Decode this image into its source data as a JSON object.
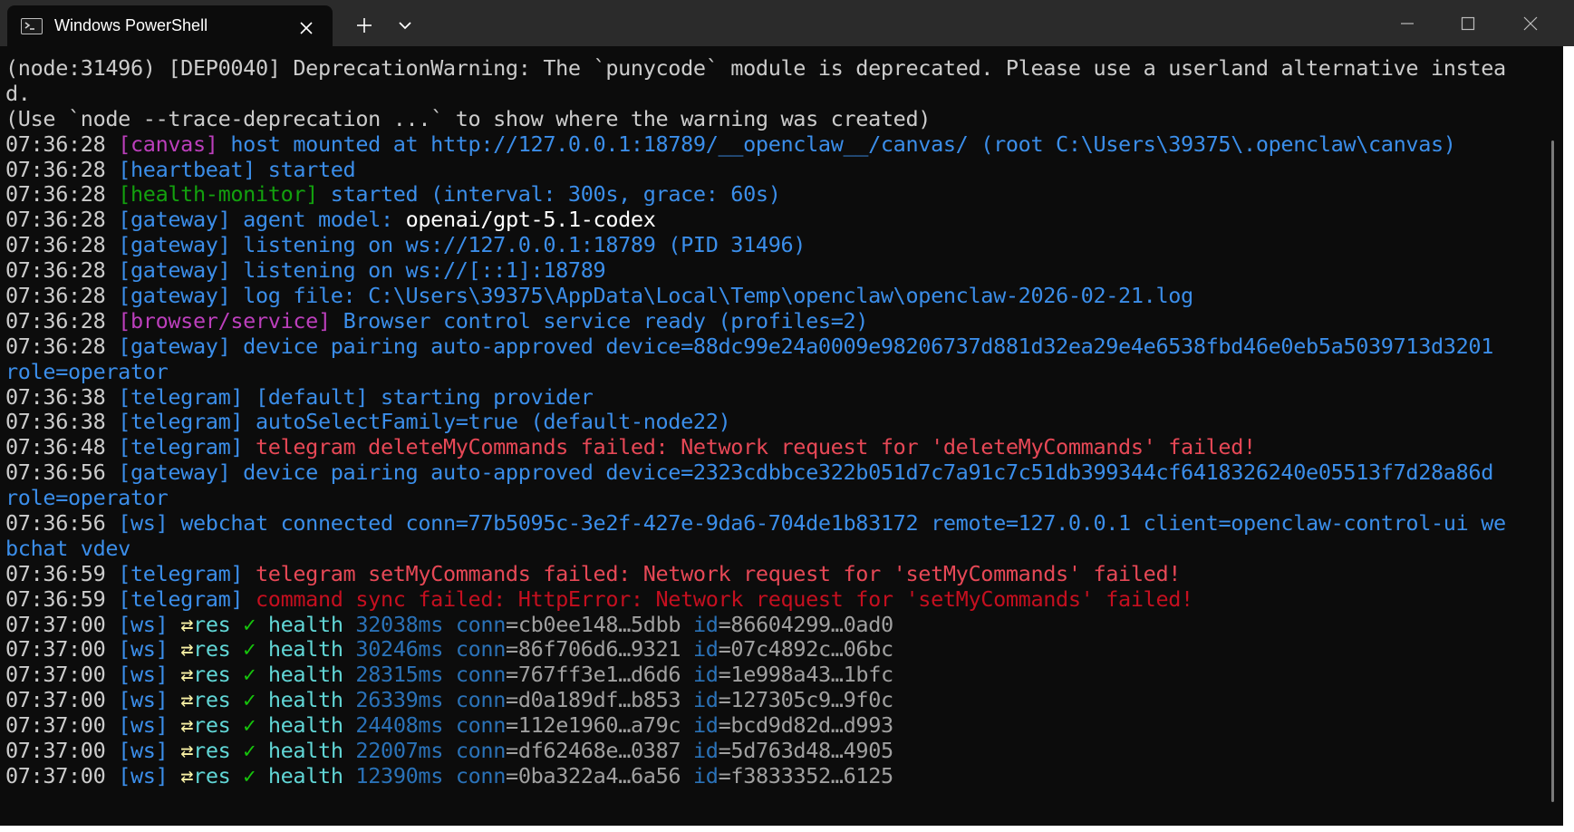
{
  "window": {
    "tab_title": "Windows PowerShell",
    "icons": {
      "tab": "terminal-icon",
      "close": "close-icon",
      "new_tab": "plus-icon",
      "dropdown": "chevron-down-icon",
      "minimize": "minimize-icon",
      "maximize": "maximize-icon",
      "window_close": "close-icon"
    }
  },
  "console": {
    "lines": [
      [
        {
          "t": "(node:31496) [DEP0040] DeprecationWarning: The `punycode` module is deprecated. Please use a userland alternative instea",
          "c": "gray"
        }
      ],
      [
        {
          "t": "d.",
          "c": "gray"
        }
      ],
      [
        {
          "t": "(Use `node --trace-deprecation ...` to show where the warning was created)",
          "c": "gray"
        }
      ],
      [
        {
          "t": "07:36:28 ",
          "c": "gray"
        },
        {
          "t": "[canvas]",
          "c": "magenta"
        },
        {
          "t": " host mounted at http://127.0.0.1:18789/__openclaw__/canvas/ (root C:\\Users\\39375\\.openclaw\\canvas)",
          "c": "blue"
        }
      ],
      [
        {
          "t": "07:36:28 ",
          "c": "gray"
        },
        {
          "t": "[heartbeat]",
          "c": "blue"
        },
        {
          "t": " started",
          "c": "blue"
        }
      ],
      [
        {
          "t": "07:36:28 ",
          "c": "gray"
        },
        {
          "t": "[health-monitor]",
          "c": "green"
        },
        {
          "t": " started (interval: 300s, grace: 60s)",
          "c": "blue"
        }
      ],
      [
        {
          "t": "07:36:28 ",
          "c": "gray"
        },
        {
          "t": "[gateway]",
          "c": "blue"
        },
        {
          "t": " agent model: ",
          "c": "blue"
        },
        {
          "t": "openai/gpt-5.1-codex",
          "c": "white"
        }
      ],
      [
        {
          "t": "07:36:28 ",
          "c": "gray"
        },
        {
          "t": "[gateway]",
          "c": "blue"
        },
        {
          "t": " listening on ws://127.0.0.1:18789 (PID 31496)",
          "c": "blue"
        }
      ],
      [
        {
          "t": "07:36:28 ",
          "c": "gray"
        },
        {
          "t": "[gateway]",
          "c": "blue"
        },
        {
          "t": " listening on ws://[::1]:18789",
          "c": "blue"
        }
      ],
      [
        {
          "t": "07:36:28 ",
          "c": "gray"
        },
        {
          "t": "[gateway]",
          "c": "blue"
        },
        {
          "t": " log file: C:\\Users\\39375\\AppData\\Local\\Temp\\openclaw\\openclaw-2026-02-21.log",
          "c": "blue"
        }
      ],
      [
        {
          "t": "07:36:28 ",
          "c": "gray"
        },
        {
          "t": "[browser/service]",
          "c": "magenta"
        },
        {
          "t": " Browser control service ready (profiles=2)",
          "c": "blue"
        }
      ],
      [
        {
          "t": "07:36:28 ",
          "c": "gray"
        },
        {
          "t": "[gateway]",
          "c": "blue"
        },
        {
          "t": " device pairing auto-approved device=88dc99e24a0009e98206737d881d32ea29e4e6538fbd46e0eb5a5039713d3201",
          "c": "blue"
        }
      ],
      [
        {
          "t": "role=operator",
          "c": "blue"
        }
      ],
      [
        {
          "t": "07:36:38 ",
          "c": "gray"
        },
        {
          "t": "[telegram]",
          "c": "blue"
        },
        {
          "t": " [default] starting provider",
          "c": "blue"
        }
      ],
      [
        {
          "t": "07:36:38 ",
          "c": "gray"
        },
        {
          "t": "[telegram]",
          "c": "blue"
        },
        {
          "t": " autoSelectFamily=true (default-node22)",
          "c": "blue"
        }
      ],
      [
        {
          "t": "07:36:48 ",
          "c": "gray"
        },
        {
          "t": "[telegram]",
          "c": "blue"
        },
        {
          "t": " telegram deleteMyCommands failed: Network request for 'deleteMyCommands' failed!",
          "c": "red"
        }
      ],
      [
        {
          "t": "07:36:56 ",
          "c": "gray"
        },
        {
          "t": "[gateway]",
          "c": "blue"
        },
        {
          "t": " device pairing auto-approved device=2323cdbbce322b051d7c7a91c7c51db399344cf6418326240e05513f7d28a86d",
          "c": "blue"
        }
      ],
      [
        {
          "t": "role=operator",
          "c": "blue"
        }
      ],
      [
        {
          "t": "07:36:56 ",
          "c": "gray"
        },
        {
          "t": "[ws]",
          "c": "blue"
        },
        {
          "t": " webchat connected conn=77b5095c-3e2f-427e-9da6-704de1b83172 remote=127.0.0.1 client=openclaw-control-ui we",
          "c": "blue"
        }
      ],
      [
        {
          "t": "bchat vdev",
          "c": "blue"
        }
      ],
      [
        {
          "t": "07:36:59 ",
          "c": "gray"
        },
        {
          "t": "[telegram]",
          "c": "blue"
        },
        {
          "t": " telegram setMyCommands failed: Network request for 'setMyCommands' failed!",
          "c": "red"
        }
      ],
      [
        {
          "t": "07:36:59 ",
          "c": "gray"
        },
        {
          "t": "[telegram]",
          "c": "blue"
        },
        {
          "t": " command sync failed: HttpError: Network request for 'setMyCommands' failed!",
          "c": "red2"
        }
      ],
      [
        {
          "t": "07:37:00 ",
          "c": "gray"
        },
        {
          "t": "[ws]",
          "c": "blue"
        },
        {
          "t": " ",
          "c": "gray"
        },
        {
          "t": "⇄",
          "c": "yellow"
        },
        {
          "t": "res ",
          "c": "cyan"
        },
        {
          "t": "✓",
          "c": "bgreen"
        },
        {
          "t": " health ",
          "c": "cyan"
        },
        {
          "t": "32038ms ",
          "c": "dim"
        },
        {
          "t": "conn",
          "c": "dim"
        },
        {
          "t": "=cb0ee148…5dbb ",
          "c": "lgray"
        },
        {
          "t": "id",
          "c": "dim"
        },
        {
          "t": "=86604299…0ad0",
          "c": "lgray"
        }
      ],
      [
        {
          "t": "07:37:00 ",
          "c": "gray"
        },
        {
          "t": "[ws]",
          "c": "blue"
        },
        {
          "t": " ",
          "c": "gray"
        },
        {
          "t": "⇄",
          "c": "yellow"
        },
        {
          "t": "res ",
          "c": "cyan"
        },
        {
          "t": "✓",
          "c": "bgreen"
        },
        {
          "t": " health ",
          "c": "cyan"
        },
        {
          "t": "30246ms ",
          "c": "dim"
        },
        {
          "t": "conn",
          "c": "dim"
        },
        {
          "t": "=86f706d6…9321 ",
          "c": "lgray"
        },
        {
          "t": "id",
          "c": "dim"
        },
        {
          "t": "=07c4892c…06bc",
          "c": "lgray"
        }
      ],
      [
        {
          "t": "07:37:00 ",
          "c": "gray"
        },
        {
          "t": "[ws]",
          "c": "blue"
        },
        {
          "t": " ",
          "c": "gray"
        },
        {
          "t": "⇄",
          "c": "yellow"
        },
        {
          "t": "res ",
          "c": "cyan"
        },
        {
          "t": "✓",
          "c": "bgreen"
        },
        {
          "t": " health ",
          "c": "cyan"
        },
        {
          "t": "28315ms ",
          "c": "dim"
        },
        {
          "t": "conn",
          "c": "dim"
        },
        {
          "t": "=767ff3e1…d6d6 ",
          "c": "lgray"
        },
        {
          "t": "id",
          "c": "dim"
        },
        {
          "t": "=1e998a43…1bfc",
          "c": "lgray"
        }
      ],
      [
        {
          "t": "07:37:00 ",
          "c": "gray"
        },
        {
          "t": "[ws]",
          "c": "blue"
        },
        {
          "t": " ",
          "c": "gray"
        },
        {
          "t": "⇄",
          "c": "yellow"
        },
        {
          "t": "res ",
          "c": "cyan"
        },
        {
          "t": "✓",
          "c": "bgreen"
        },
        {
          "t": " health ",
          "c": "cyan"
        },
        {
          "t": "26339ms ",
          "c": "dim"
        },
        {
          "t": "conn",
          "c": "dim"
        },
        {
          "t": "=d0a189df…b853 ",
          "c": "lgray"
        },
        {
          "t": "id",
          "c": "dim"
        },
        {
          "t": "=127305c9…9f0c",
          "c": "lgray"
        }
      ],
      [
        {
          "t": "07:37:00 ",
          "c": "gray"
        },
        {
          "t": "[ws]",
          "c": "blue"
        },
        {
          "t": " ",
          "c": "gray"
        },
        {
          "t": "⇄",
          "c": "yellow"
        },
        {
          "t": "res ",
          "c": "cyan"
        },
        {
          "t": "✓",
          "c": "bgreen"
        },
        {
          "t": " health ",
          "c": "cyan"
        },
        {
          "t": "24408ms ",
          "c": "dim"
        },
        {
          "t": "conn",
          "c": "dim"
        },
        {
          "t": "=112e1960…a79c ",
          "c": "lgray"
        },
        {
          "t": "id",
          "c": "dim"
        },
        {
          "t": "=bcd9d82d…d993",
          "c": "lgray"
        }
      ],
      [
        {
          "t": "07:37:00 ",
          "c": "gray"
        },
        {
          "t": "[ws]",
          "c": "blue"
        },
        {
          "t": " ",
          "c": "gray"
        },
        {
          "t": "⇄",
          "c": "yellow"
        },
        {
          "t": "res ",
          "c": "cyan"
        },
        {
          "t": "✓",
          "c": "bgreen"
        },
        {
          "t": " health ",
          "c": "cyan"
        },
        {
          "t": "22007ms ",
          "c": "dim"
        },
        {
          "t": "conn",
          "c": "dim"
        },
        {
          "t": "=df62468e…0387 ",
          "c": "lgray"
        },
        {
          "t": "id",
          "c": "dim"
        },
        {
          "t": "=5d763d48…4905",
          "c": "lgray"
        }
      ],
      [
        {
          "t": "07:37:00 ",
          "c": "gray"
        },
        {
          "t": "[ws]",
          "c": "blue"
        },
        {
          "t": " ",
          "c": "gray"
        },
        {
          "t": "⇄",
          "c": "yellow"
        },
        {
          "t": "res ",
          "c": "cyan"
        },
        {
          "t": "✓",
          "c": "bgreen"
        },
        {
          "t": " health ",
          "c": "cyan"
        },
        {
          "t": "12390ms ",
          "c": "dim"
        },
        {
          "t": "conn",
          "c": "dim"
        },
        {
          "t": "=0ba322a4…6a56 ",
          "c": "lgray"
        },
        {
          "t": "id",
          "c": "dim"
        },
        {
          "t": "=f3833352…6125",
          "c": "lgray"
        }
      ]
    ]
  }
}
